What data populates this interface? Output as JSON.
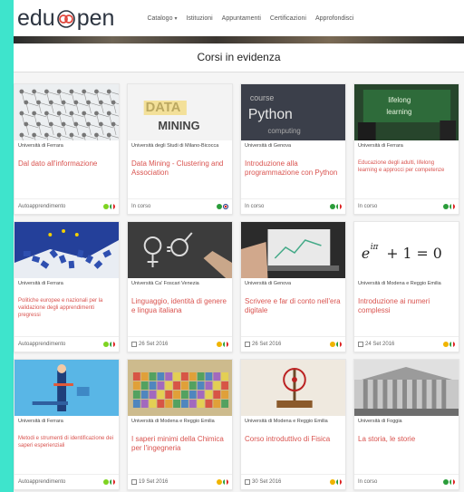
{
  "nav": {
    "logo_left": "edu",
    "logo_right": "pen",
    "menu": [
      "Catalogo",
      "Istituzioni",
      "Appuntamenti",
      "Certificazioni",
      "Approfondisci"
    ]
  },
  "section_title": "Corsi in evidenza",
  "colors": {
    "accent": "#d9534f",
    "ongoing_dot": "#2a9d3a",
    "scheduled_dot": "#f0b400",
    "self_dot": "#7ed321"
  },
  "cards": [
    {
      "university": "Università di Ferrara",
      "title": "Dal dato all'informazione",
      "status": "Autoapprendimento",
      "status_dot": "green",
      "flag": "it",
      "thumb": "network-icon"
    },
    {
      "university": "Università degli Studi di Milano-Bicocca",
      "title": "Data Mining - Clustering and Association",
      "status": "In corso",
      "status_dot": "darkgreen",
      "flag": "uk",
      "thumb": "data-mining-icon"
    },
    {
      "university": "Università di Genova",
      "title": "Introduzione alla programmazione con Python",
      "status": "In corso",
      "status_dot": "darkgreen",
      "flag": "it",
      "thumb": "python-icon"
    },
    {
      "university": "Università di Ferrara",
      "title": "Educazione degli adulti, lifelong learning e approcci per competenze",
      "status": "In corso",
      "status_dot": "darkgreen",
      "flag": "it",
      "thumb": "lifelong-learning-icon"
    },
    {
      "university": "Università di Ferrara",
      "title": "Politiche europee e nazionali per la validazione degli apprendimenti pregressi",
      "status": "Autoapprendimento",
      "status_dot": "green",
      "flag": "it",
      "thumb": "eu-puzzle-icon"
    },
    {
      "university": "Università Ca' Foscari Venezia",
      "title": "Linguaggio, identità di genere e lingua italiana",
      "status": "26 Set 2016",
      "status_dot": "yellow",
      "flag": "it",
      "thumb": "gender-symbols-icon"
    },
    {
      "university": "Università di Genova",
      "title": "Scrivere e far di conto nell'era digitale",
      "status": "26 Set 2016",
      "status_dot": "yellow",
      "flag": "it",
      "thumb": "laptop-writing-icon"
    },
    {
      "university": "Università di Modena e Reggio Emilia",
      "title": "Introduzione ai numeri complessi",
      "status": "24 Set 2016",
      "status_dot": "yellow",
      "flag": "it",
      "thumb": "euler-formula-icon"
    },
    {
      "university": "Università di Ferrara",
      "title": "Metodi e strumenti di identificazione dei saperi esperienziali",
      "status": "Autoapprendimento",
      "status_dot": "green",
      "flag": "it",
      "thumb": "balance-icon"
    },
    {
      "university": "Università di Modena e Reggio Emilia",
      "title": "I saperi minimi della Chimica per l'ingegneria",
      "status": "19 Set 2016",
      "status_dot": "yellow",
      "flag": "it",
      "thumb": "periodic-table-icon"
    },
    {
      "university": "Università di Modena e Reggio Emilia",
      "title": "Corso introduttivo di Fisica",
      "status": "30 Set 2016",
      "status_dot": "yellow",
      "flag": "it",
      "thumb": "physics-device-icon"
    },
    {
      "university": "Università di Foggia",
      "title": "La storia, le storie",
      "status": "In corso",
      "status_dot": "darkgreen",
      "flag": "it",
      "thumb": "history-building-icon"
    }
  ],
  "thumb_text": {
    "data_mining": "DATA MINING",
    "python": "Python",
    "lifelong": "lifelong learning",
    "euler": "e^{iπ} + 1 = 0"
  }
}
